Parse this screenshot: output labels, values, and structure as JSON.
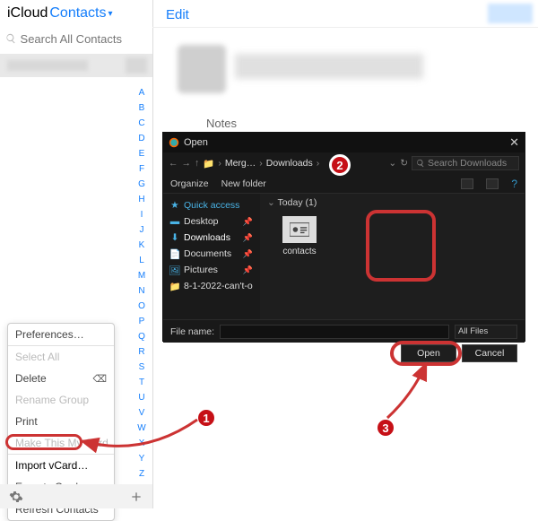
{
  "header": {
    "icloud": "iCloud",
    "contacts": "Contacts"
  },
  "search": {
    "placeholder": "Search All Contacts"
  },
  "alpha": [
    "A",
    "B",
    "C",
    "D",
    "E",
    "F",
    "G",
    "H",
    "I",
    "J",
    "K",
    "L",
    "M",
    "N",
    "O",
    "P",
    "Q",
    "R",
    "S",
    "T",
    "U",
    "V",
    "W",
    "X",
    "Y",
    "Z",
    "#"
  ],
  "menu": {
    "preferences": "Preferences…",
    "select_all": "Select All",
    "delete": "Delete",
    "rename_group": "Rename Group",
    "print": "Print",
    "make_my_card": "Make This My Card",
    "import_vcard": "Import vCard…",
    "export_vcard": "Export vCard…",
    "refresh": "Refresh Contacts"
  },
  "right": {
    "edit": "Edit",
    "notes": "Notes"
  },
  "dialog": {
    "title": "Open",
    "crumb1": "Merg…",
    "crumb2": "Downloads",
    "search_ph": "Search Downloads",
    "organize": "Organize",
    "new_folder": "New folder",
    "side_qa": "Quick access",
    "side_desktop": "Desktop",
    "side_downloads": "Downloads",
    "side_documents": "Documents",
    "side_pictures": "Pictures",
    "side_item5": "8-1-2022-can't-o",
    "group_today": "Today (1)",
    "file_label": "contacts",
    "file_name_label": "File name:",
    "filter": "All Files",
    "open_btn": "Open",
    "cancel_btn": "Cancel"
  },
  "badges": {
    "b1": "1",
    "b2": "2",
    "b3": "3"
  }
}
